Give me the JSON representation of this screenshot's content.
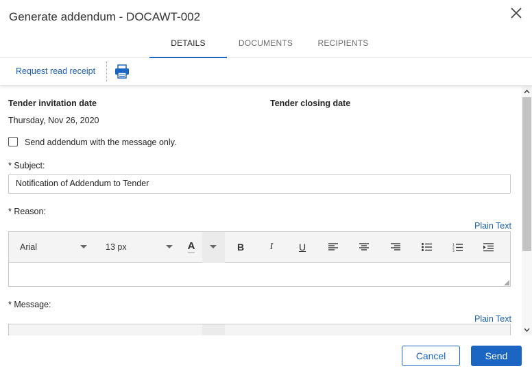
{
  "dialog": {
    "title": "Generate addendum - DOCAWT-002",
    "close_icon": "close-icon"
  },
  "tabs": [
    {
      "label": "DETAILS",
      "active": true
    },
    {
      "label": "DOCUMENTS",
      "active": false
    },
    {
      "label": "RECIPIENTS",
      "active": false
    }
  ],
  "toolbar": {
    "read_receipt_label": "Request read receipt",
    "print_icon": "print-icon"
  },
  "form": {
    "tender_invitation_label": "Tender invitation date",
    "tender_invitation_value": "Thursday, Nov 26, 2020",
    "tender_closing_label": "Tender closing date",
    "tender_closing_value": "",
    "checkbox_label": "Send addendum with the message only.",
    "checkbox_checked": false,
    "subject_label": "* Subject:",
    "subject_value": "Notification of Addendum to Tender",
    "reason_label": "* Reason:",
    "message_label": "* Message:",
    "plain_text_label": "Plain Text"
  },
  "editor": {
    "font_family": "Arial",
    "font_size": "13 px",
    "text_color_glyph": "A",
    "bold_glyph": "B",
    "italic_glyph": "I",
    "underline_glyph": "U",
    "icons": [
      "font-color-icon",
      "bold-icon",
      "italic-icon",
      "underline-icon",
      "align-left-icon",
      "align-center-icon",
      "align-right-icon",
      "bullet-list-icon",
      "numbered-list-icon",
      "indent-icon"
    ]
  },
  "footer": {
    "cancel_label": "Cancel",
    "send_label": "Send"
  },
  "colors": {
    "accent": "#1a66c2",
    "link": "#1a5fb4",
    "border": "#c8c8c8"
  }
}
